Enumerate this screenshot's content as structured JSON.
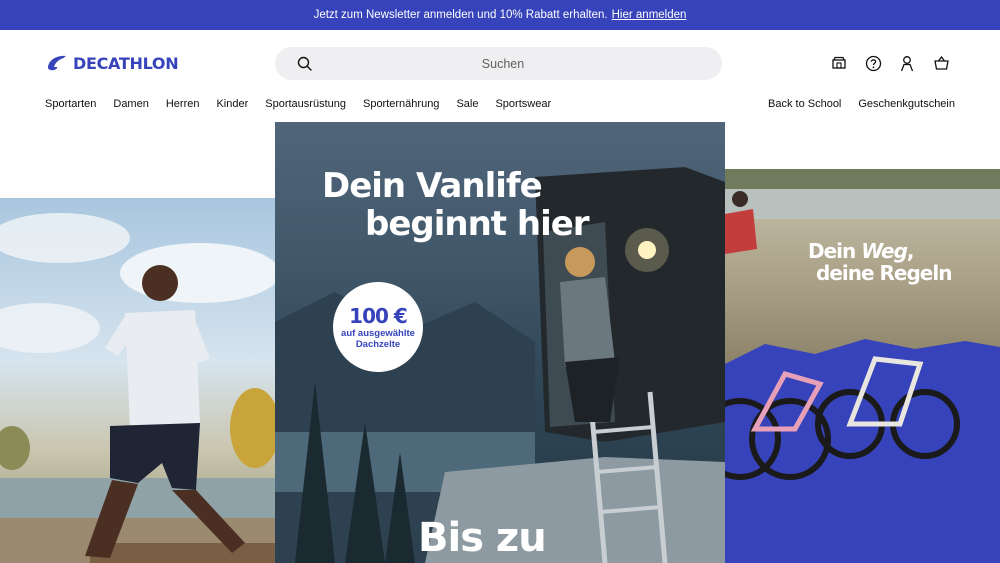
{
  "promo": {
    "text": "Jetzt zum Newsletter anmelden und 10% Rabatt erhalten.",
    "link": "Hier anmelden"
  },
  "header": {
    "logo": "DECATHLON",
    "search_placeholder": "Suchen",
    "icons": [
      "store-icon",
      "help-icon",
      "account-icon",
      "cart-icon"
    ]
  },
  "nav": {
    "items": [
      "Sportarten",
      "Damen",
      "Herren",
      "Kinder",
      "Sportausrüstung",
      "Sporternährung",
      "Sale",
      "Sportswear"
    ],
    "right": [
      "Back to School",
      "Geschenkgutschein"
    ]
  },
  "hero": {
    "center": {
      "title_line1": "Dein Vanlife",
      "title_line2": "beginnt hier",
      "badge_price": "100 €",
      "badge_line1": "auf ausgewählte",
      "badge_line2": "Dachzelte",
      "bottom_text": "Bis zu"
    },
    "right": {
      "title_part1": "Dein ",
      "title_italic": "Weg",
      "title_part2": ",",
      "title_line2": "deine Regeln"
    }
  },
  "colors": {
    "brand": "#3643ba",
    "search_bg": "#efeff1"
  }
}
